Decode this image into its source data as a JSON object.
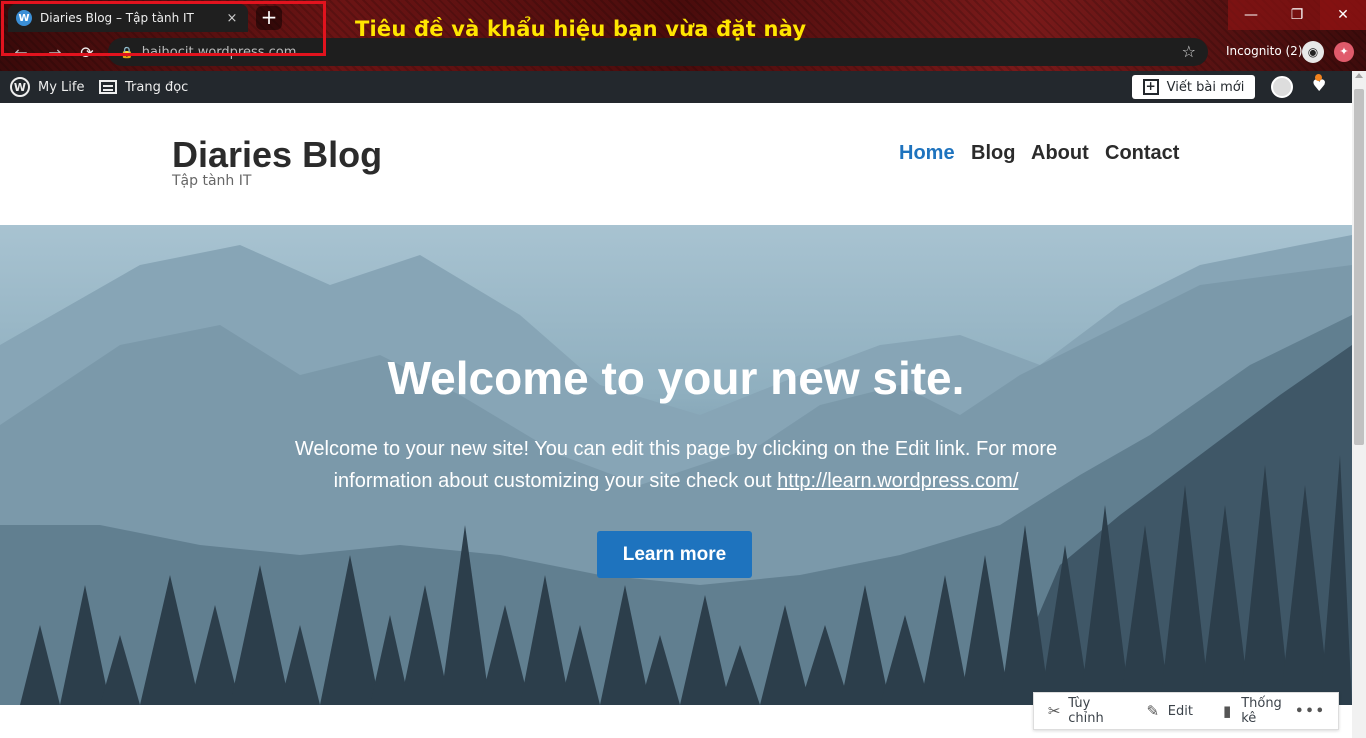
{
  "browser": {
    "tab_title": "Diaries Blog – Tập tành IT",
    "tab_close": "×",
    "new_tab": "+",
    "url": "haihocit.wordpress.com",
    "incognito_label": "Incognito (2)",
    "window_controls": {
      "minimize": "—",
      "maximize": "❐",
      "close": "✕"
    },
    "nav": {
      "back": "←",
      "forward": "→",
      "reload": "⟳"
    },
    "bookmark": "☆"
  },
  "annotation": {
    "text": "Tiêu đề và khẩu hiệu bạn vừa đặt này",
    "text_color": "#ffe600",
    "box_color": "#e2131e"
  },
  "admin_bar": {
    "site_name": "My Life",
    "reader": "Trang đọc",
    "write_post": "Viết bài mới"
  },
  "site": {
    "title": "Diaries Blog",
    "tagline": "Tập tành IT",
    "menu": [
      {
        "label": "Home",
        "active": true
      },
      {
        "label": "Blog",
        "active": false
      },
      {
        "label": "About",
        "active": false
      },
      {
        "label": "Contact",
        "active": false
      }
    ],
    "accent_color": "#1e73be"
  },
  "hero": {
    "heading": "Welcome to your new site.",
    "text_line1": "Welcome to your new site! You can edit this page by clicking on the Edit link. For more",
    "text_line2_prefix": "information about customizing your site check out ",
    "link": "http://learn.wordpress.com/",
    "button": "Learn more"
  },
  "action_bar": {
    "customize": "Tùy chỉnh",
    "edit": "Edit",
    "stats": "Thống kê",
    "more": "•••"
  }
}
